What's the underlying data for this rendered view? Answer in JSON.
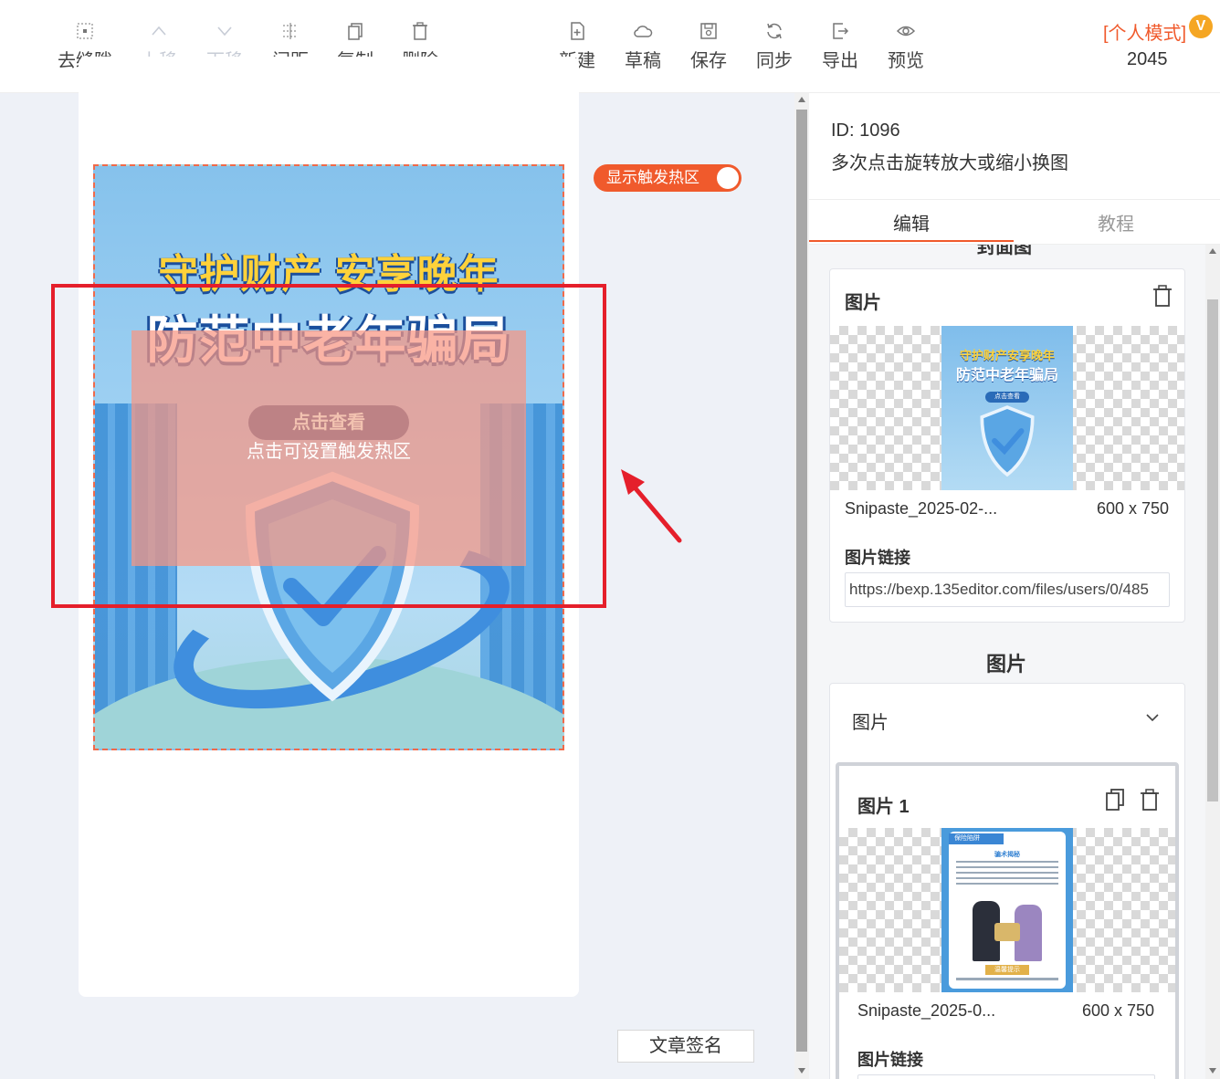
{
  "toolbar": {
    "remove_gap": "去缝隙",
    "move_up": "上移",
    "move_down": "下移",
    "spacing": "间距",
    "copy": "复制",
    "delete": "删除",
    "new": "新建",
    "draft": "草稿",
    "save": "保存",
    "sync": "同步",
    "export": "导出",
    "preview": "预览",
    "mode_label": "[个人模式]",
    "mode_badge": "V",
    "count": "2045"
  },
  "canvas": {
    "toggle_label": "显示触发热区",
    "poster_title1": "守护财产 安享晚年",
    "poster_title2": "防范中老年骗局",
    "poster_button": "点击查看",
    "hotzone_hint": "点击可设置触发热区",
    "signature_button": "文章签名"
  },
  "panel": {
    "id_text": "ID: 1096",
    "description": "多次点击旋转放大或缩小换图",
    "tabs": [
      "编辑",
      "教程"
    ],
    "clipped_section": "封面图",
    "cover_card": {
      "title": "图片",
      "thumb_title1": "守护财产安享晚年",
      "thumb_title2": "防范中老年骗局",
      "thumb_button": "点击查看",
      "filename": "Snipaste_2025-02-...",
      "size": "600 x 750",
      "link_label": "图片链接",
      "link_value": "https://bexp.135editor.com/files/users/0/485"
    },
    "images_section": "图片",
    "images_dropdown": "图片",
    "image1_card": {
      "title": "图片 1",
      "thumb_tag": "保险陷阱",
      "thumb_heading": "骗术揭秘",
      "thumb_footer": "温馨提示",
      "filename": "Snipaste_2025-0...",
      "size": "600 x 750",
      "link_label": "图片链接"
    }
  },
  "colors": {
    "accent": "#f05a2c",
    "highlight_red": "#e51f2b",
    "hotzone": "#f89682"
  }
}
